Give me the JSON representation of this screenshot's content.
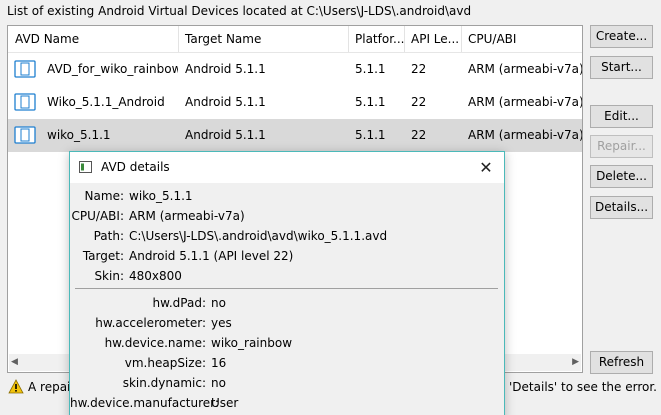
{
  "header": {
    "text": "List of existing Android Virtual Devices located at C:\\Users\\J-LDS\\.android\\avd"
  },
  "table": {
    "columns": [
      "AVD Name",
      "Target Name",
      "Platfor...",
      "API Le...",
      "CPU/ABI"
    ],
    "rows": [
      {
        "name": "AVD_for_wiko_rainbow",
        "target": "Android 5.1.1",
        "platform": "5.1.1",
        "api": "22",
        "cpu": "ARM (armeabi-v7a)",
        "icon": "device-icon"
      },
      {
        "name": "Wiko_5.1.1_Android",
        "target": "Android 5.1.1",
        "platform": "5.1.1",
        "api": "22",
        "cpu": "ARM (armeabi-v7a)",
        "icon": "device-icon"
      },
      {
        "name": "wiko_5.1.1",
        "target": "Android 5.1.1",
        "platform": "5.1.1",
        "api": "22",
        "cpu": "ARM (armeabi-v7a)",
        "icon": "device-icon",
        "selected": true
      }
    ]
  },
  "buttons": {
    "create": "Create...",
    "start": "Start...",
    "edit": "Edit...",
    "repair": "Repair...",
    "delete": "Delete...",
    "details": "Details...",
    "refresh": "Refresh"
  },
  "footer": {
    "left": "A repair",
    "right": "'Details' to see the error.",
    "icon": "warning-icon"
  },
  "dialog": {
    "title": "AVD details",
    "close": "✕",
    "fields": [
      {
        "label": "Name:",
        "value": "wiko_5.1.1"
      },
      {
        "label": "CPU/ABI:",
        "value": "ARM (armeabi-v7a)"
      },
      {
        "label": "Path:",
        "value": "C:\\Users\\J-LDS\\.android\\avd\\wiko_5.1.1.avd"
      },
      {
        "label": "Target:",
        "value": "Android 5.1.1 (API level 22)"
      },
      {
        "label": "Skin:",
        "value": "480x800"
      }
    ],
    "properties": [
      {
        "label": "hw.dPad:",
        "value": "no"
      },
      {
        "label": "hw.accelerometer:",
        "value": "yes"
      },
      {
        "label": "hw.device.name:",
        "value": "wiko_rainbow"
      },
      {
        "label": "vm.heapSize:",
        "value": "16"
      },
      {
        "label": "skin.dynamic:",
        "value": "no"
      },
      {
        "label": "hw.device.manufacturer:",
        "value": "User"
      }
    ]
  },
  "colors": {
    "dialog_border": "#4bb9b9",
    "selected_row": "#d9d9d9",
    "device_icon": "#1e7fd0",
    "warning": "#f2c30c"
  }
}
